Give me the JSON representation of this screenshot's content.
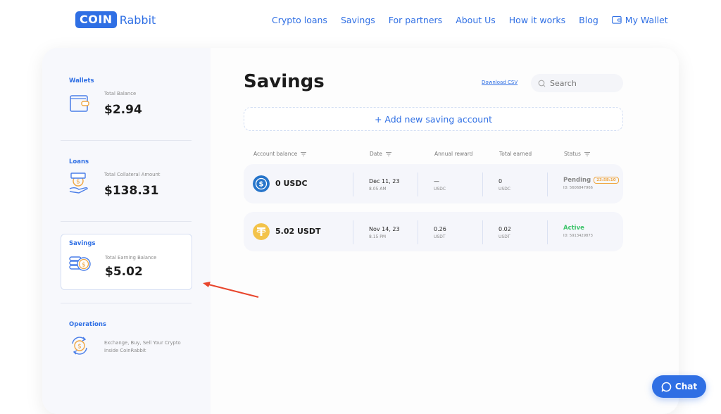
{
  "header": {
    "logo_box": "COIN",
    "logo_text": "Rabbit",
    "nav": [
      "Crypto loans",
      "Savings",
      "For partners",
      "About Us",
      "How it works",
      "Blog"
    ],
    "wallet_label": "My Wallet"
  },
  "sidebar": {
    "wallets": {
      "title": "Wallets",
      "label": "Total Balance",
      "value": "$2.94",
      "icon": "wallet-icon"
    },
    "loans": {
      "title": "Loans",
      "label": "Total Collateral Amount",
      "value": "$138.31",
      "icon": "money-bag-hand-icon"
    },
    "savings": {
      "title": "Savings",
      "label": "Total Earning Balance",
      "value": "$5.02",
      "icon": "coins-stack-icon",
      "selected": true
    },
    "operations": {
      "title": "Operations",
      "line1": "Exchange, Buy, Sell Your Crypto",
      "line2": "Inside CoinRabbit",
      "icon": "exchange-dollar-icon"
    }
  },
  "main": {
    "title": "Savings",
    "download_csv": "Download CSV",
    "search_placeholder": "Search",
    "add_button": "+ Add new saving account",
    "columns": [
      "Account balance",
      "Date",
      "Annual reward",
      "Total earned",
      "Status"
    ],
    "rows": [
      {
        "coin": "USDC",
        "coin_color": "#2775ca",
        "balance": "0 USDC",
        "date": "Dec 11, 23",
        "time": "8.05 AM",
        "annual_reward": "—",
        "annual_unit": "USDC",
        "total_earned": "0",
        "earned_unit": "USDC",
        "status": "Pending",
        "status_color": "#888888",
        "timer": "23:58:10",
        "id": "ID: 5606847966"
      },
      {
        "coin": "USDT",
        "coin_color": "#f3c34a",
        "balance": "5.02 USDT",
        "date": "Nov 14, 23",
        "time": "8.15 PM",
        "annual_reward": "0.26",
        "annual_unit": "USDT",
        "total_earned": "0.02",
        "earned_unit": "USDT",
        "status": "Active",
        "status_color": "#3cc46a",
        "id": "ID: 5913429873"
      }
    ]
  },
  "chat": {
    "label": "Chat"
  },
  "colors": {
    "accent": "#2f6fe4",
    "annotation_arrow": "#e8452c"
  }
}
